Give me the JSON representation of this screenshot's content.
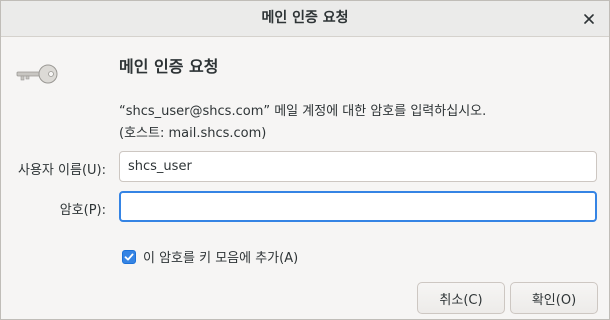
{
  "window": {
    "title": "메인 인증 요청",
    "close_icon": "close-icon"
  },
  "dialog": {
    "icon": "key-icon",
    "heading": "메인 인증 요청",
    "message_line1": "“shcs_user@shcs.com” 메일 계정에 대한 암호를 입력하십시오.",
    "message_line2": "(호스트: mail.shcs.com)"
  },
  "form": {
    "username_label": "사용자 이름(U):",
    "username_value": "shcs_user",
    "password_label": "암호(P):",
    "password_value": "",
    "remember_label": "이 암호를 키 모음에 추가(A)",
    "remember_checked": true
  },
  "buttons": {
    "cancel_label": "취소(C)",
    "ok_label": "확인(O)"
  },
  "colors": {
    "accent": "#3584e4",
    "titlebar": "#ebebea",
    "background": "#f6f5f4"
  }
}
